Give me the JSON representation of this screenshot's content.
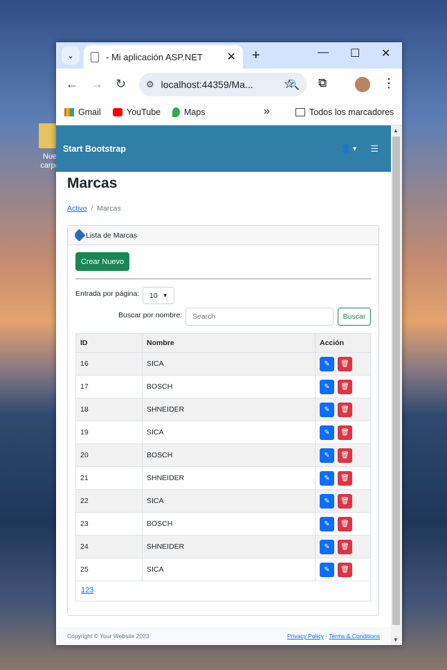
{
  "desktop": {
    "folder_label_1": "Nue",
    "folder_label_2": "carpe"
  },
  "browser": {
    "tab_title": "- Mi aplicación ASP.NET",
    "address": "localhost:44359/Ma...",
    "bookmarks": [
      "Gmail",
      "YouTube",
      "Maps"
    ],
    "bookmarks_all": "Todos los marcadores",
    "more": "»"
  },
  "navbar": {
    "brand": "Start Bootstrap",
    "user_icon": "▾"
  },
  "page": {
    "title": "Marcas",
    "breadcrumb": {
      "link": "Activo",
      "sep": "/",
      "current": "Marcas"
    },
    "card_title": "Lista de Marcas",
    "create_button": "Crear Nuevo",
    "per_page_label": "Entrada por página:",
    "per_page_value": "10",
    "search_label": "Buscar por nombre:",
    "search_placeholder": "Search",
    "search_button": "Buscar",
    "table": {
      "headers": [
        "ID",
        "Nombre",
        "Acción"
      ],
      "rows": [
        {
          "id": "16",
          "name": "SICA"
        },
        {
          "id": "17",
          "name": "BOSCH"
        },
        {
          "id": "18",
          "name": "SHNEIDER"
        },
        {
          "id": "19",
          "name": "SICA"
        },
        {
          "id": "20",
          "name": "BOSCH"
        },
        {
          "id": "21",
          "name": "SHNEIDER"
        },
        {
          "id": "22",
          "name": "SICA"
        },
        {
          "id": "23",
          "name": "BOSCH"
        },
        {
          "id": "24",
          "name": "SHNEIDER"
        },
        {
          "id": "25",
          "name": "SICA"
        }
      ]
    },
    "pages": [
      "1",
      "2",
      "3"
    ]
  },
  "footer": {
    "copyright": "Copyright © Your Website 2023",
    "privacy": "Privacy Policy",
    "sep": "·",
    "terms": "Terms & Conditions"
  },
  "colors": {
    "navbar": "#2f7fa9",
    "create": "#198754",
    "edit": "#0d6efd",
    "delete": "#dc3545"
  }
}
